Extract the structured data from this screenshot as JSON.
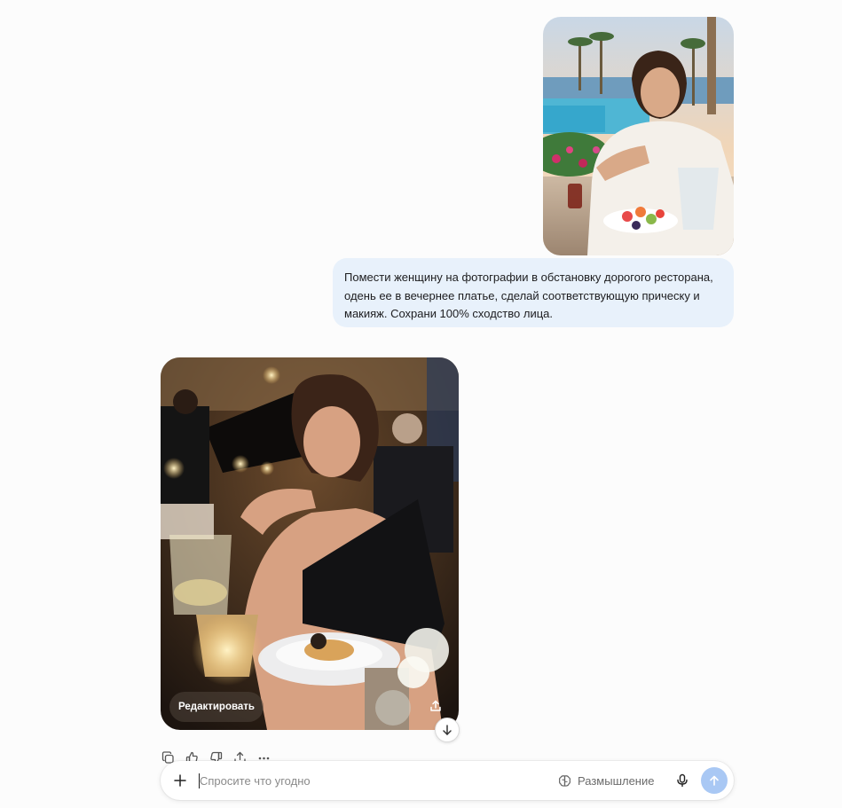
{
  "user_message": {
    "attachment_icon": "photo-attachment",
    "text": "Помести женщину на фотографии в обстановку дорогого ресторана, одень ее в вечернее платье, сделай соответствующую прическу и макияж. Сохрани 100% сходство лица."
  },
  "assistant_message": {
    "image_icon": "generated-image",
    "edit_label": "Редактировать",
    "share_icon": "share-icon",
    "actions": [
      "copy-icon",
      "thumbs-up-icon",
      "thumbs-down-icon",
      "share-icon",
      "more-icon"
    ]
  },
  "scroll_icon": "arrow-down-icon",
  "composer": {
    "placeholder": "Спросите что угодно",
    "value": "",
    "thinking_label": "Размышление",
    "icons": [
      "plus-icon",
      "brain-icon",
      "mic-icon",
      "send-arrow-icon"
    ],
    "send_color": "#a9c8f4"
  },
  "colors": {
    "background": "#fcfcfc",
    "user_bubble": "#e8f1fb"
  }
}
